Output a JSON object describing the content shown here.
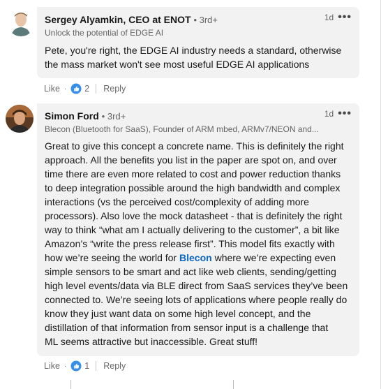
{
  "comments": [
    {
      "name": "Sergey Alyamkin, CEO at ENOT",
      "degree": "• 3rd+",
      "headline": "Unlock the potential of EDGE AI",
      "time": "1d",
      "more_icon": "more-horizontal-icon",
      "lines": [
        "Pete, you're right, the EDGE AI industry needs a standard, otherwise",
        "the mass market won't see most useful EDGE AI applications"
      ],
      "like_label": "Like",
      "reaction_icon": "like-reaction-icon",
      "reaction_count": "2",
      "reply_label": "Reply"
    },
    {
      "name": "Simon Ford",
      "degree": "• 3rd+",
      "headline": "Blecon (Bluetooth for SaaS), Founder of ARM mbed, ARMv7/NEON and...",
      "time": "1d",
      "more_icon": "more-horizontal-icon",
      "lines": [
        "Great to give this concept a concrete name. This is definitely the right",
        "approach. All the benefits you list in the paper are spot on, and over",
        "time there are even more related to cost and power reduction thanks",
        "to deep integration possible around the high bandwidth and complex",
        "interactions (vs the perceived cost/complexity of adding more",
        "processors). Also love the mock datasheet - that is definitely the right",
        "way to think “what am I actually delivering to the customer”, a bit like",
        "Amazon’s “write the press release first”. This model fits exactly with"
      ],
      "line9_prefix": "how we’re seeing the world for ",
      "line9_link": "Blecon",
      "line9_suffix": " where we’re expecting even",
      "lines_after": [
        "simple sensors to be smart and act like web clients, sending/getting",
        "high level events/data via BLE direct from SaaS services they’ve been",
        "connected to. We’re seeing lots of applications where people really do",
        "know they just want data on some high level concept, and the",
        "distillation of that information from sensor input is a challenge that",
        "ML seems attractive but inaccessible. Great stuff!"
      ],
      "like_label": "Like",
      "reaction_icon": "like-reaction-icon",
      "reaction_count": "1",
      "reply_label": "Reply"
    }
  ],
  "colors": {
    "bubble": "#f2f2f2",
    "link": "#0a66c2",
    "like_blue": "#378fe9"
  }
}
